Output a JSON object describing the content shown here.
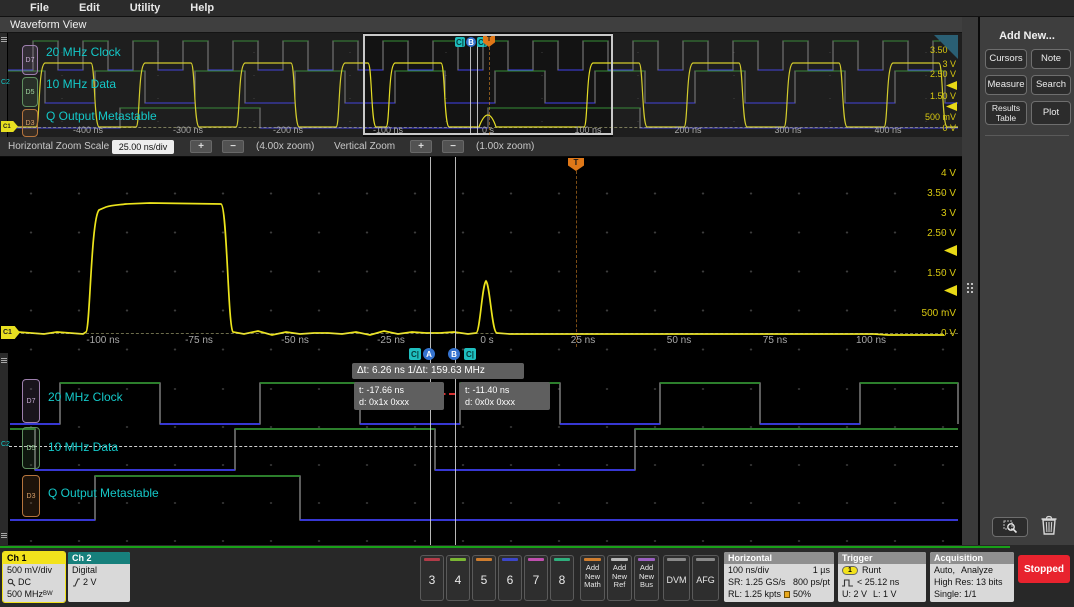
{
  "colors": {
    "ch1_yellow": "#ece41c",
    "digital_label_cyan": "#14c8c8",
    "digital_high_green": "#2e8b2e",
    "digital_low_blue": "#3a3aec",
    "stopped_red": "#e8232e",
    "trigger_orange": "#e07818",
    "selected_channel_yellow": "#f2e21c",
    "ch2_header_teal": "#17807c"
  },
  "menu": {
    "items": [
      "File",
      "Edit",
      "Utility",
      "Help"
    ]
  },
  "view_tab": "Waveform View",
  "overview": {
    "channels": [
      {
        "badge": "D7",
        "label": "20 MHz Clock"
      },
      {
        "badge": "D5",
        "label": "10 MHz Data"
      },
      {
        "badge": "D3",
        "label": "Q Output Metastable"
      }
    ],
    "group_label": "C2",
    "ground_marker": "C1",
    "volt_labels": [
      "3.50 V",
      "3 V",
      "2.50 V",
      "1.50 V",
      "500 mV",
      "0 V"
    ],
    "time_labels": [
      "-400 ns",
      "-300 ns",
      "-200 ns",
      "-100 ns",
      "0 s",
      "100 ns",
      "200 ns",
      "300 ns",
      "400 ns"
    ],
    "cursor_chips": [
      "C|",
      "B",
      "C|"
    ],
    "trigger_marker": "T"
  },
  "zoom_toolbar": {
    "label": "Horizontal Zoom Scale",
    "scale_value": "25.00 ns/div",
    "plus_label": "+",
    "minus_label": "−",
    "h_zoom": "(4.00x zoom)",
    "vertical_label": "Vertical Zoom",
    "v_zoom": "(1.00x zoom)",
    "close_label": "✕"
  },
  "main_view": {
    "volt_labels": [
      "4 V",
      "3.50 V",
      "3 V",
      "2.50 V",
      "1.50 V",
      "500 mV",
      "0 V"
    ],
    "time_labels": [
      "-100 ns",
      "-75 ns",
      "-50 ns",
      "-25 ns",
      "0 s",
      "25 ns",
      "50 ns",
      "75 ns",
      "100 ns"
    ],
    "trigger_marker": "T",
    "ground_marker": "C1"
  },
  "cursors": {
    "chips": [
      "C|",
      "A",
      "B",
      "C|"
    ],
    "delta_readout": "Δt:  6.26 ns 1/Δt:  159.63 MHz",
    "a": {
      "t": "t: -17.66 ns",
      "d": "d: 0x1x 0xxx"
    },
    "b": {
      "t": "t: -11.40 ns",
      "d": "d: 0x0x 0xxx"
    }
  },
  "digital_view": {
    "group_label": "C2",
    "channels": [
      {
        "badge": "D7",
        "label": "20 MHz Clock"
      },
      {
        "badge": "D5",
        "label": "10 MHz Data"
      },
      {
        "badge": "D3",
        "label": "Q Output Metastable"
      }
    ]
  },
  "sidebar": {
    "title": "Add New...",
    "buttons": [
      "Cursors",
      "Note",
      "Measure",
      "Search",
      "Results Table",
      "Plot"
    ]
  },
  "status_bar": {
    "ch1": {
      "title": "Ch 1",
      "scale": "500 mV/div",
      "coupling": "DC",
      "bandwidth": "500 MHz",
      "bw_suffix": "BW"
    },
    "ch2": {
      "title": "Ch 2",
      "mode": "Digital",
      "threshold": "2 V"
    },
    "channel_buttons": [
      "3",
      "4",
      "5",
      "6",
      "7",
      "8"
    ],
    "add_math": {
      "l1": "Add",
      "l2": "New",
      "l3": "Math"
    },
    "add_ref": {
      "l1": "Add",
      "l2": "New",
      "l3": "Ref"
    },
    "add_bus": {
      "l1": "Add",
      "l2": "New",
      "l3": "Bus"
    },
    "dvm": "DVM",
    "afg": "AFG",
    "horizontal": {
      "title": "Horizontal",
      "scale": "100 ns/div",
      "window": "1 µs",
      "sample_rate": "SR: 1.25 GS/s",
      "resolution": "800 ps/pt",
      "record_length": "RL: 1.25 kpts",
      "position": "50%"
    },
    "trigger": {
      "title": "Trigger",
      "source": "1",
      "type": "Runt",
      "condition": "< 25.12 ns",
      "upper": "U: 2 V",
      "lower": "L: 1 V"
    },
    "acquisition": {
      "title": "Acquisition",
      "mode": "Auto,",
      "analyze": "Analyze",
      "detail": "High Res: 13 bits",
      "single": "Single: 1/1"
    },
    "stopped": "Stopped"
  }
}
